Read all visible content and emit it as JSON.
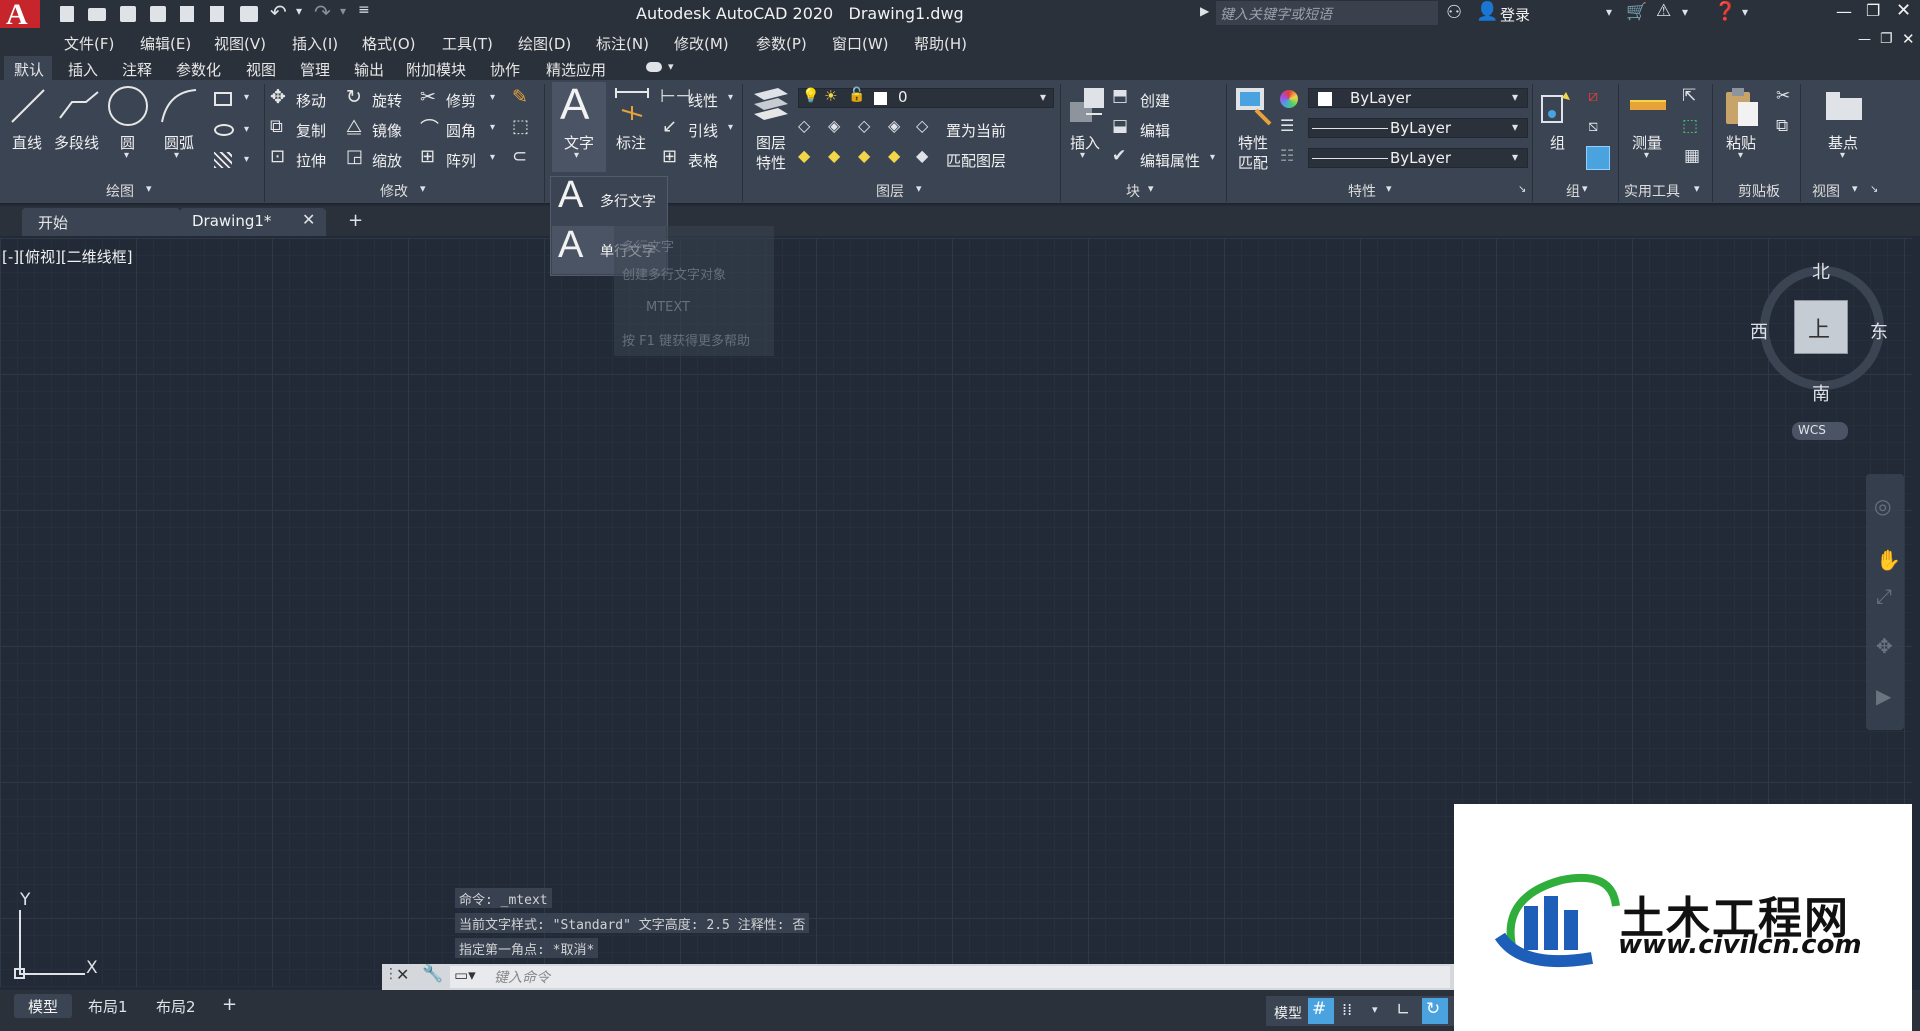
{
  "app": {
    "title": "Autodesk AutoCAD 2020",
    "doc": "Drawing1.dwg",
    "search_placeholder": "键入关键字或短语",
    "login": "登录",
    "logo": "A"
  },
  "menu": [
    "文件(F)",
    "编辑(E)",
    "视图(V)",
    "插入(I)",
    "格式(O)",
    "工具(T)",
    "绘图(D)",
    "标注(N)",
    "修改(M)",
    "参数(P)",
    "窗口(W)",
    "帮助(H)"
  ],
  "ribbon_tabs": [
    "默认",
    "插入",
    "注释",
    "参数化",
    "视图",
    "管理",
    "输出",
    "附加模块",
    "协作",
    "精选应用"
  ],
  "draw": {
    "line": "直线",
    "polyline": "多段线",
    "circle": "圆",
    "arc": "圆弧",
    "panel": "绘图"
  },
  "modify": {
    "move": "移动",
    "rotate": "旋转",
    "trim": "修剪",
    "copy": "复制",
    "mirror": "镜像",
    "fillet": "圆角",
    "stretch": "拉伸",
    "scale": "缩放",
    "array": "阵列",
    "panel": "修改"
  },
  "annotation": {
    "text": "文字",
    "dimension": "标注",
    "linear": "线性",
    "leader": "引线",
    "table": "表格"
  },
  "layers": {
    "layer_props_1": "图层",
    "layer_props_2": "特性",
    "layer_name": "0",
    "set_current": "置为当前",
    "match_layer": "匹配图层",
    "panel": "图层"
  },
  "block": {
    "insert": "插入",
    "create": "创建",
    "edit": "编辑",
    "edit_attr": "编辑属性",
    "panel": "块"
  },
  "properties": {
    "match_1": "特性",
    "match_2": "匹配",
    "color": "ByLayer",
    "lineweight": "ByLayer",
    "linetype": "ByLayer",
    "panel": "特性"
  },
  "groups": {
    "group": "组",
    "panel": "组"
  },
  "utilities": {
    "measure": "测量",
    "panel": "实用工具"
  },
  "clipboard": {
    "paste": "粘贴",
    "panel": "剪贴板"
  },
  "view": {
    "base": "基点",
    "panel": "视图"
  },
  "text_dropdown": {
    "mtext": "多行文字",
    "single": "单行文字"
  },
  "tooltip": {
    "line1": "多行文字",
    "line2": "创建多行文字对象",
    "cmd": "MTEXT",
    "help": "按 F1 键获得更多帮助"
  },
  "doc_tabs": {
    "start": "开始",
    "drawing": "Drawing1*"
  },
  "viewport_label": "[-][俯视][二维线框]",
  "viewcube": {
    "north": "北",
    "south": "南",
    "east": "东",
    "west": "西",
    "top": "上",
    "wcs": "WCS"
  },
  "ucs": {
    "x": "X",
    "y": "Y"
  },
  "command": {
    "history": [
      "命令: _mtext",
      "当前文字样式: \"Standard\"  文字高度:  2.5  注释性:  否",
      "指定第一角点: *取消*"
    ],
    "placeholder": "键入命令"
  },
  "layout_tabs": [
    "模型",
    "布局1",
    "布局2"
  ],
  "status": {
    "model": "模型"
  },
  "watermark": {
    "cn": "土木工程网",
    "url": "www.civilcn.com"
  },
  "colors": {
    "accent": "#e8282b",
    "canvas": "#212a36",
    "ribbon": "#3b4453",
    "selected_blue": "#4aa3df"
  }
}
